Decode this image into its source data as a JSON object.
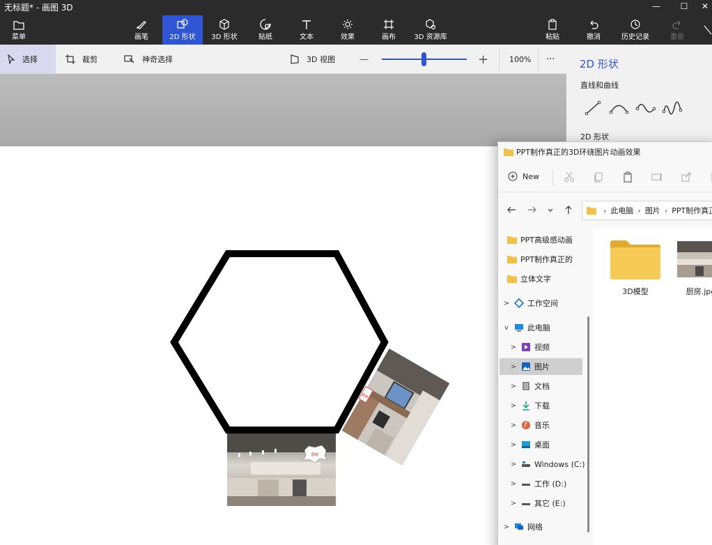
{
  "window": {
    "title": "无标题* - 画图 3D",
    "controls": {
      "minimize": "—",
      "maximize": "☐",
      "close": "✕"
    }
  },
  "menu": {
    "label": "菜单",
    "icon": "folder-icon"
  },
  "tools": [
    {
      "label": "画笔",
      "icon": "brush-icon",
      "active": false
    },
    {
      "label": "2D 形状",
      "icon": "2d-shapes-icon",
      "active": true
    },
    {
      "label": "3D 形状",
      "icon": "3d-shapes-icon",
      "active": false
    },
    {
      "label": "贴纸",
      "icon": "sticker-icon",
      "active": false
    },
    {
      "label": "文本",
      "icon": "text-icon",
      "active": false
    },
    {
      "label": "效果",
      "icon": "effects-icon",
      "active": false
    },
    {
      "label": "画布",
      "icon": "canvas-icon",
      "active": false
    },
    {
      "label": "3D 资源库",
      "icon": "3d-library-icon",
      "active": false
    }
  ],
  "actions": [
    {
      "label": "粘贴",
      "icon": "paste-icon",
      "disabled": false
    },
    {
      "label": "撤消",
      "icon": "undo-icon",
      "disabled": false
    },
    {
      "label": "历史记录",
      "icon": "history-icon",
      "disabled": false
    },
    {
      "label": "重做",
      "icon": "redo-icon",
      "disabled": true
    }
  ],
  "subtoolbar": {
    "select": "选择",
    "crop": "裁剪",
    "magic_select": "神奇选择",
    "view_3d": "3D 视图",
    "zoom_minus": "—",
    "zoom_plus": "+",
    "zoom_value": "100%",
    "zoom_level": 0.47,
    "more": "···"
  },
  "side_panel": {
    "title": "2D 形状",
    "lines_label": "直线和曲线",
    "line_tools": [
      "line-icon",
      "curve-icon",
      "s-curve-icon",
      "wave-curve-icon"
    ],
    "shapes_label": "2D 形状"
  },
  "colors": {
    "accent": "#2f55d4",
    "topbar": "#2b2b2b",
    "toolbar": "#f1f1f1",
    "folder": "#f2c14a"
  },
  "explorer": {
    "title": "PPT制作真正的3D环绕图片动画效果",
    "new_label": "New",
    "breadcrumb": [
      "此电脑",
      "图片",
      "PPT制作真正"
    ],
    "tree": [
      {
        "label": "PPT高级感动画",
        "icon": "folder-icon",
        "expander": "",
        "selected": false
      },
      {
        "label": "PPT制作真正的",
        "icon": "folder-icon",
        "expander": "",
        "selected": false
      },
      {
        "label": "立体文字",
        "icon": "folder-icon",
        "expander": "",
        "selected": false
      },
      {
        "label": "工作空间",
        "icon": "workspace-icon",
        "expander": ">",
        "selected": false
      },
      {
        "label": "此电脑",
        "icon": "computer-icon",
        "expander": "v",
        "selected": false
      },
      {
        "label": "视频",
        "icon": "video-icon",
        "expander": ">",
        "selected": false
      },
      {
        "label": "图片",
        "icon": "pictures-icon",
        "expander": ">",
        "selected": true
      },
      {
        "label": "文档",
        "icon": "documents-icon",
        "expander": ">",
        "selected": false
      },
      {
        "label": "下载",
        "icon": "download-icon",
        "expander": ">",
        "selected": false
      },
      {
        "label": "音乐",
        "icon": "music-icon",
        "expander": ">",
        "selected": false
      },
      {
        "label": "桌面",
        "icon": "desktop-icon",
        "expander": ">",
        "selected": false
      },
      {
        "label": "Windows (C:)",
        "icon": "drive-icon",
        "expander": ">",
        "selected": false
      },
      {
        "label": "工作 (D:)",
        "icon": "drive-icon",
        "expander": ">",
        "selected": false
      },
      {
        "label": "其它 (E:)",
        "icon": "drive-icon",
        "expander": ">",
        "selected": false
      },
      {
        "label": "网络",
        "icon": "network-icon",
        "expander": ">",
        "selected": false
      }
    ],
    "files": [
      {
        "name": "3D模型",
        "type": "folder"
      },
      {
        "name": "厨房.jpg",
        "type": "image"
      }
    ]
  },
  "canvas": {
    "shape": "hexagon",
    "images": [
      {
        "name": "kitchen-photo-rotated",
        "sign": "厨房"
      },
      {
        "name": "kitchen-photo",
        "sign": "厨房"
      }
    ]
  }
}
